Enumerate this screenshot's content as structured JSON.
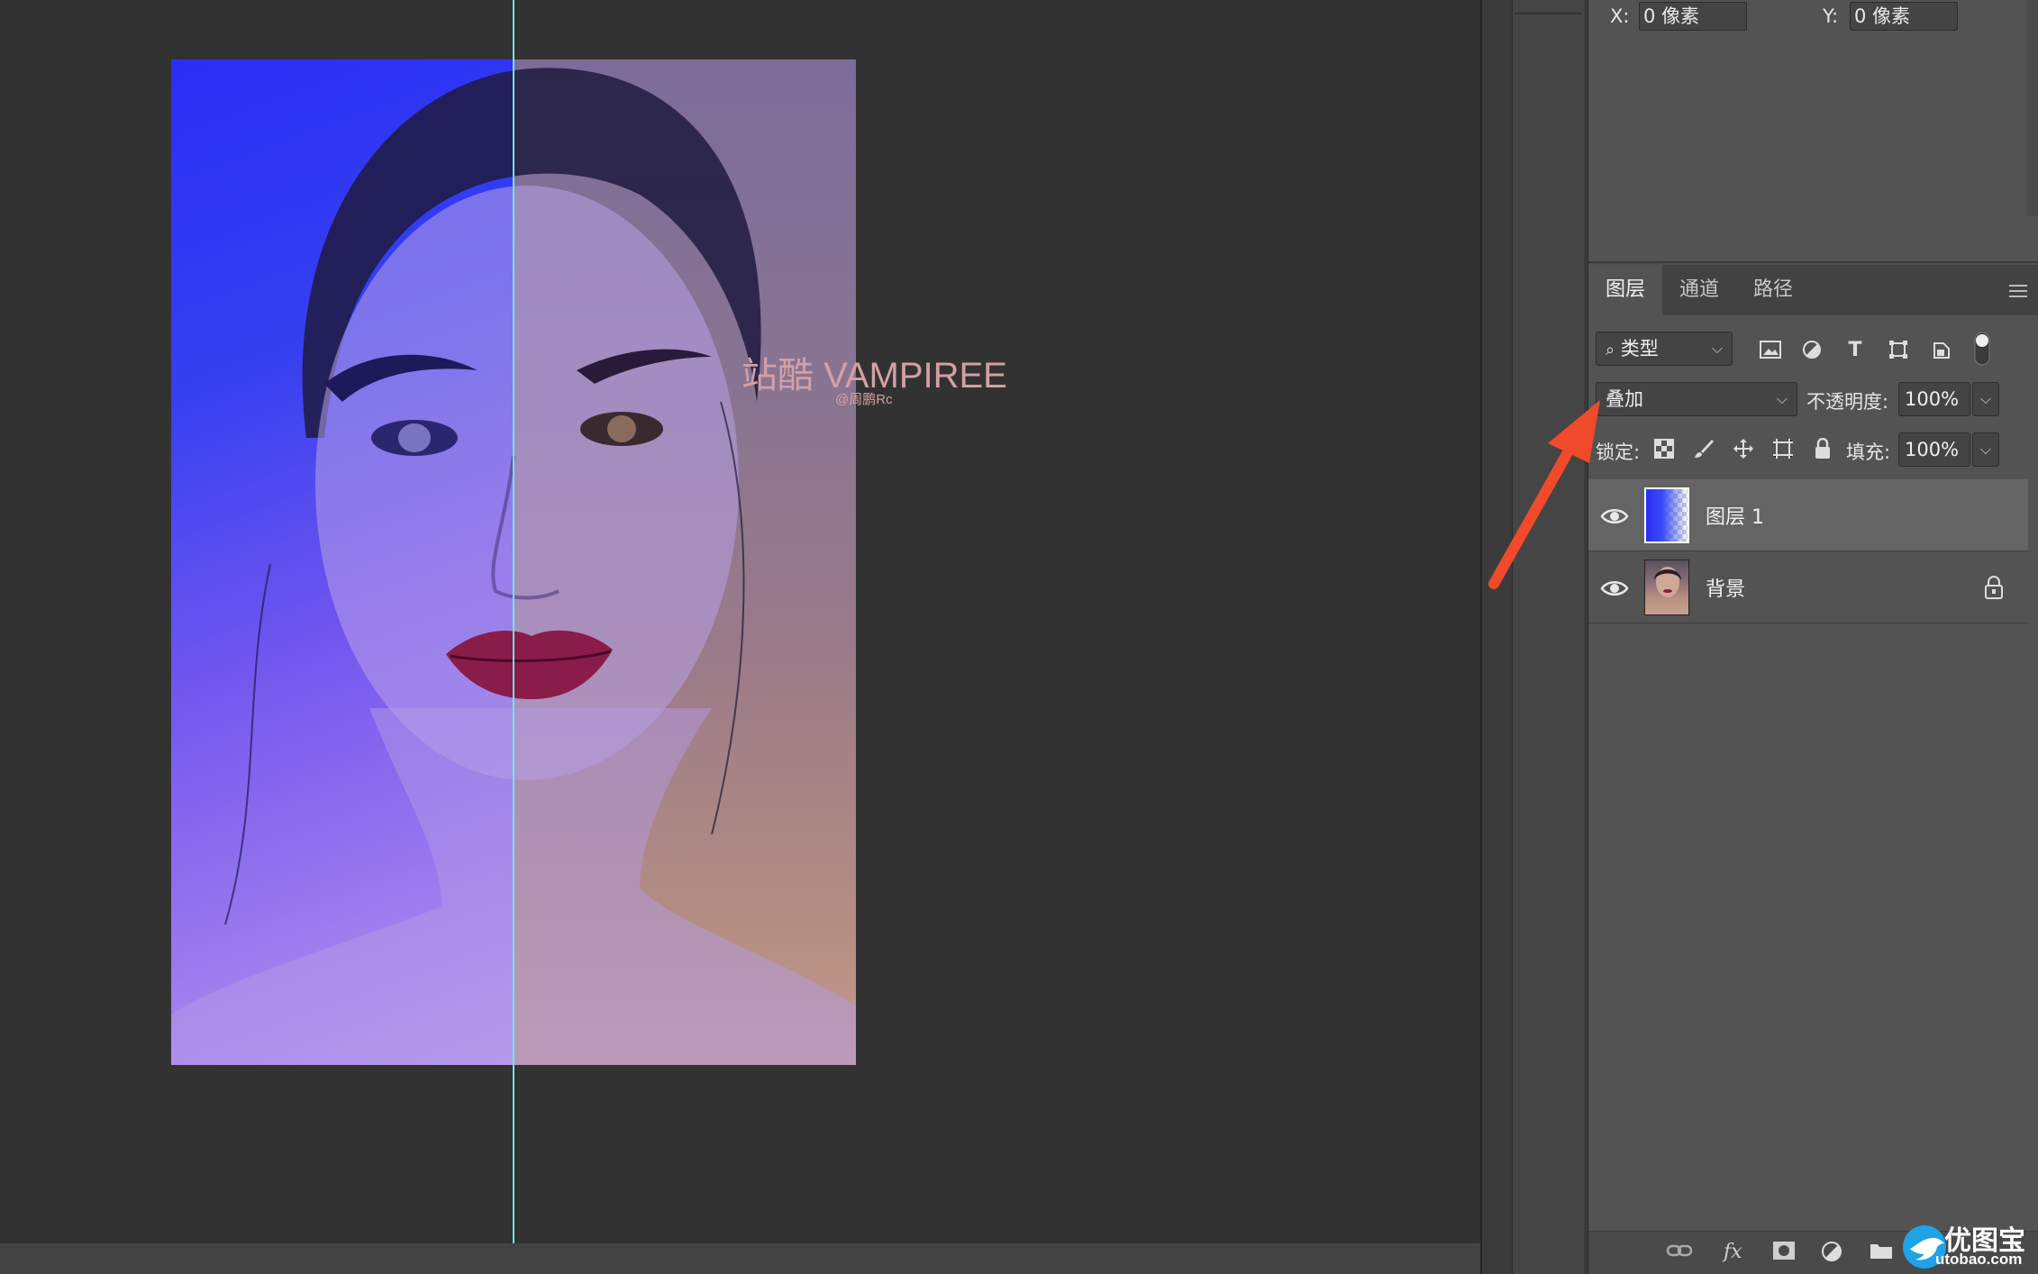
{
  "canvas": {
    "headline": "站酷 VAMPIREE",
    "credit": "@周鹏Rc"
  },
  "properties": {
    "x_label": "X:",
    "x_value": "0 像素",
    "y_label": "Y:",
    "y_value": "0 像素"
  },
  "layers_panel": {
    "tabs": [
      {
        "label": "图层",
        "active": true
      },
      {
        "label": "通道",
        "active": false
      },
      {
        "label": "路径",
        "active": false
      }
    ],
    "filter_kind": "类型",
    "blend_mode": "叠加",
    "opacity_label": "不透明度:",
    "opacity_value": "100%",
    "lock_label": "锁定:",
    "fill_label": "填充:",
    "fill_value": "100%",
    "layers": [
      {
        "name": "图层 1",
        "visible": true,
        "selected": true,
        "locked": false
      },
      {
        "name": "背景",
        "visible": true,
        "selected": false,
        "locked": true
      }
    ],
    "bottom_icons": [
      "link-icon",
      "fx-icon",
      "mask-icon",
      "adjustment-icon",
      "folder-icon"
    ],
    "fx_label": "fx"
  },
  "watermark": {
    "name": "优图宝",
    "url": "utobao.com"
  },
  "colors": {
    "arrow": "#f04a2a",
    "guide": "#6fe8e0",
    "headline": "#d3a0a4",
    "gradient_blue": "#2a2ef5"
  }
}
